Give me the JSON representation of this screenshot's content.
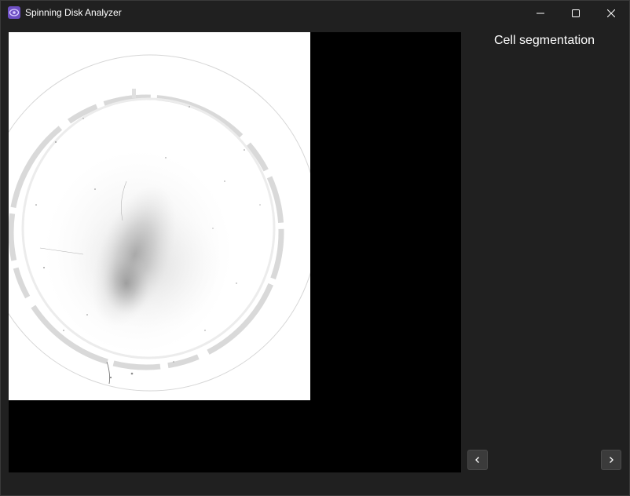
{
  "window": {
    "title": "Spinning Disk Analyzer",
    "accent": "#7b5ccf",
    "controls": [
      "minimize-icon",
      "maximize-icon",
      "close-icon"
    ]
  },
  "viewer": {
    "background": "#000000",
    "image_description_icon": "microscopy-disk-image"
  },
  "panel": {
    "title": "Cell segmentation"
  },
  "navigation": {
    "prev_icon": "chevron-left-icon",
    "next_icon": "chevron-right-icon"
  }
}
